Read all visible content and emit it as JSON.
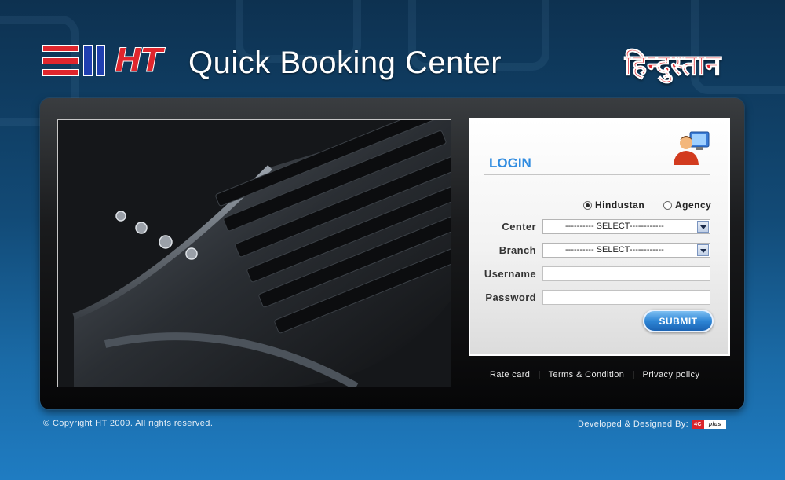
{
  "header": {
    "logo_text": "HT",
    "title": "Quick Booking Center",
    "hindi_logo": "हिन्दुस्तान"
  },
  "login": {
    "title": "LOGIN",
    "radio_options": [
      {
        "label": "Hindustan",
        "checked": true
      },
      {
        "label": "Agency",
        "checked": false
      }
    ],
    "center_label": "Center",
    "center_value": "---------- SELECT------------",
    "branch_label": "Branch",
    "branch_value": "---------- SELECT------------",
    "username_label": "Username",
    "username_value": "",
    "password_label": "Password",
    "password_value": "",
    "submit_label": "SUBMIT"
  },
  "links": {
    "rate_card": "Rate card",
    "sep": "|",
    "terms": "Terms & Condition",
    "privacy": "Privacy policy"
  },
  "footer": {
    "copyright": "© Copyright HT 2009. All rights reserved.",
    "credit": "Developed & Designed  By:",
    "dev_logo_a": "4C",
    "dev_logo_b": "plus"
  },
  "colors": {
    "accent_blue": "#2f8be0",
    "brand_red": "#e0262d",
    "ht_blue": "#1f3fb0"
  },
  "icons": [
    "user-computer-icon",
    "radio-icon",
    "dropdown-arrow-icon"
  ]
}
